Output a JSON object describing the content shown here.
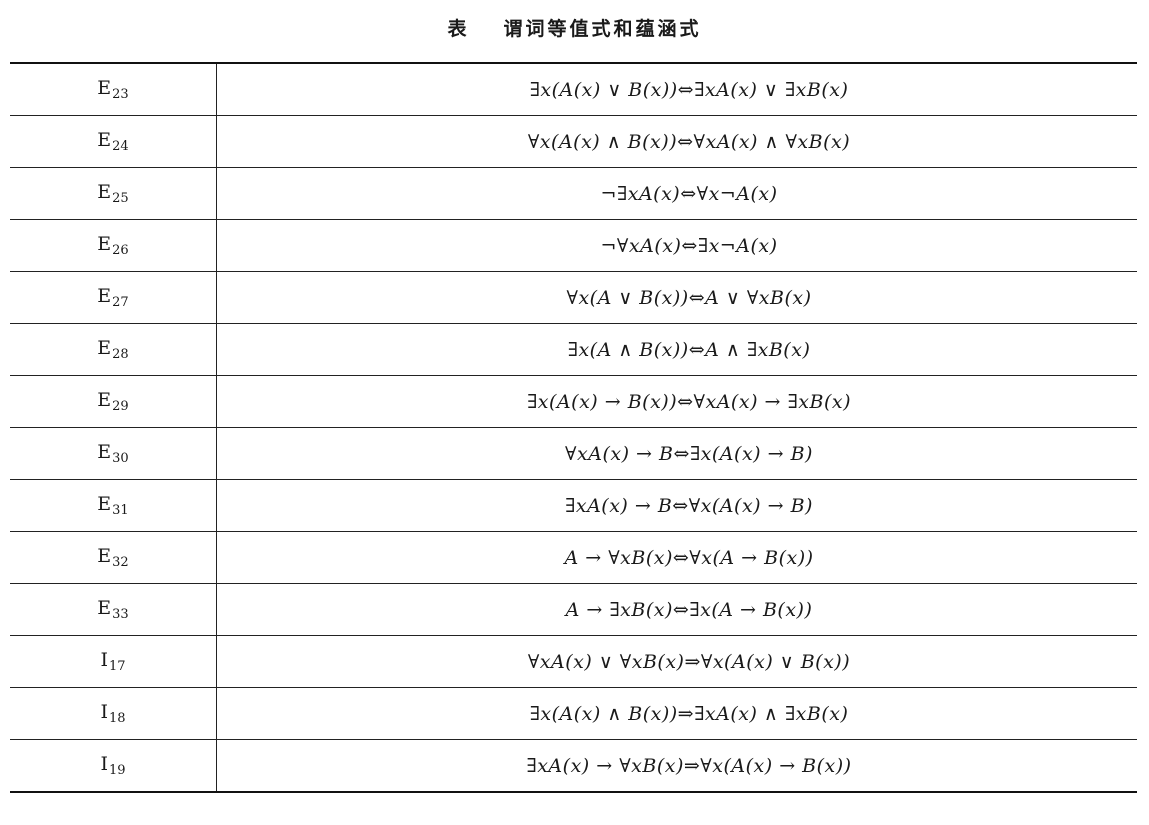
{
  "header": {
    "title_mark": "表",
    "title": "谓词等值式和蕴涵式"
  },
  "table": {
    "rows": [
      {
        "label": "E",
        "sub": "23",
        "formula": "∃x(A(x) ∨ B(x))⇔∃xA(x) ∨ ∃xB(x)"
      },
      {
        "label": "E",
        "sub": "24",
        "formula": "∀x(A(x) ∧ B(x))⇔∀xA(x) ∧ ∀xB(x)"
      },
      {
        "label": "E",
        "sub": "25",
        "formula": "¬∃xA(x)⇔∀x¬A(x)"
      },
      {
        "label": "E",
        "sub": "26",
        "formula": "¬∀xA(x)⇔∃x¬A(x)"
      },
      {
        "label": "E",
        "sub": "27",
        "formula": "∀x(A ∨ B(x))⇔A ∨ ∀xB(x)"
      },
      {
        "label": "E",
        "sub": "28",
        "formula": "∃x(A ∧ B(x))⇔A ∧ ∃xB(x)"
      },
      {
        "label": "E",
        "sub": "29",
        "formula": "∃x(A(x) → B(x))⇔∀xA(x) → ∃xB(x)"
      },
      {
        "label": "E",
        "sub": "30",
        "formula": "∀xA(x) → B⇔∃x(A(x) → B)"
      },
      {
        "label": "E",
        "sub": "31",
        "formula": "∃xA(x) → B⇔∀x(A(x) → B)"
      },
      {
        "label": "E",
        "sub": "32",
        "formula": "A → ∀xB(x)⇔∀x(A → B(x))"
      },
      {
        "label": "E",
        "sub": "33",
        "formula": "A → ∃xB(x)⇔∃x(A → B(x))"
      },
      {
        "label": "I",
        "sub": "17",
        "formula": "∀xA(x) ∨ ∀xB(x)⇒∀x(A(x) ∨ B(x))"
      },
      {
        "label": "I",
        "sub": "18",
        "formula": "∃x(A(x) ∧ B(x))⇒∃xA(x) ∧ ∃xB(x)"
      },
      {
        "label": "I",
        "sub": "19",
        "formula": "∃xA(x) → ∀xB(x)⇒∀x(A(x) → B(x))"
      }
    ]
  }
}
